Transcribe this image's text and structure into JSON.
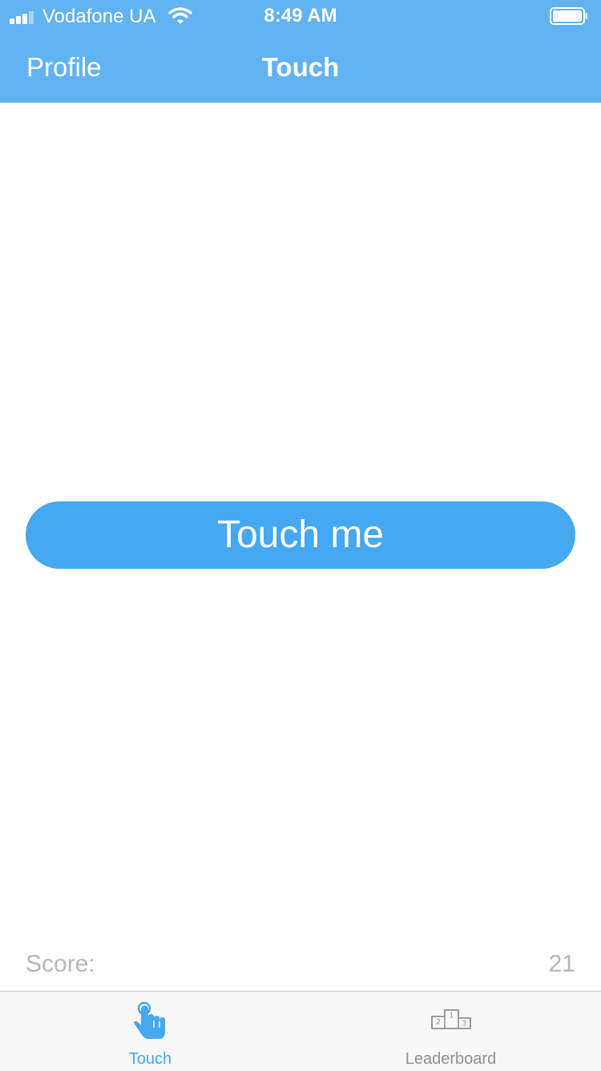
{
  "status_bar": {
    "carrier": "Vodafone UA",
    "time": "8:49 AM"
  },
  "nav": {
    "left_label": "Profile",
    "title": "Touch"
  },
  "main": {
    "button_label": "Touch me"
  },
  "score": {
    "label": "Score:",
    "value": "21"
  },
  "tabs": [
    {
      "label": "Touch",
      "icon": "tap-hand-icon",
      "active": true
    },
    {
      "label": "Leaderboard",
      "icon": "podium-icon",
      "active": false
    }
  ],
  "colors": {
    "header_bg": "#61b3f1",
    "button_bg": "#45a8f0",
    "tab_active": "#45a8f0",
    "tab_inactive": "#8e8e93",
    "score_text": "#b7b7b7"
  }
}
